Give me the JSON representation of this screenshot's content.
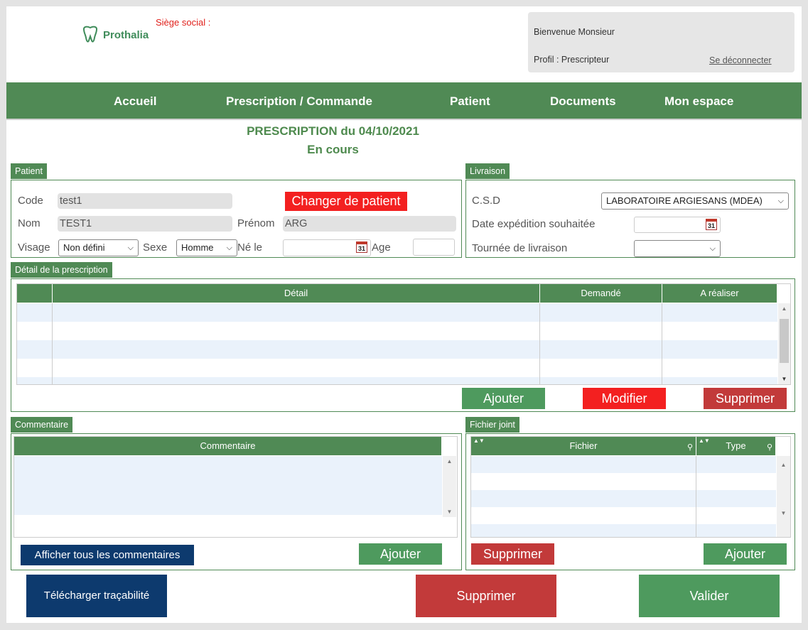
{
  "header": {
    "logo_text": "Prothalia",
    "siege_label": "Siège social :",
    "welcome": "Bienvenue Monsieur",
    "profile": "Profil : Prescripteur",
    "logout": "Se déconnecter"
  },
  "nav": [
    "Accueil",
    "Prescription / Commande",
    "Patient",
    "Documents",
    "Mon espace"
  ],
  "title": {
    "line1": "PRESCRIPTION du 04/10/2021",
    "line2": "En cours"
  },
  "patient": {
    "tab": "Patient",
    "code_label": "Code",
    "code_value": "test1",
    "change_button": "Changer de patient",
    "nom_label": "Nom",
    "nom_value": "TEST1",
    "prenom_label": "Prénom",
    "prenom_value": "ARG",
    "visage_label": "Visage",
    "visage_value": "Non défini",
    "sexe_label": "Sexe",
    "sexe_value": "Homme",
    "ne_label": "Né le",
    "age_label": "Age"
  },
  "livraison": {
    "tab": "Livraison",
    "csd_label": "C.S.D",
    "csd_value": "LABORATOIRE ARGIESANS (MDEA)",
    "date_label": "Date expédition souhaitée",
    "tournee_label": "Tournée de livraison"
  },
  "detail": {
    "tab": "Détail de la prescription",
    "columns": [
      "",
      "Détail",
      "Demandé",
      "A réaliser"
    ],
    "add": "Ajouter",
    "modify": "Modifier",
    "delete": "Supprimer"
  },
  "commentaire": {
    "tab": "Commentaire",
    "column": "Commentaire",
    "show_all": "Afficher tous les commentaires",
    "add": "Ajouter"
  },
  "fichier": {
    "tab": "Fichier joint",
    "columns": [
      "Fichier",
      "Type"
    ],
    "delete": "Supprimer",
    "add": "Ajouter"
  },
  "footer": {
    "download": "Télécharger traçabilité",
    "delete": "Supprimer",
    "validate": "Valider"
  },
  "icons": {
    "calendar": "calendar-icon",
    "chevron": "chevron-down-icon",
    "logo": "tooth-icon"
  }
}
